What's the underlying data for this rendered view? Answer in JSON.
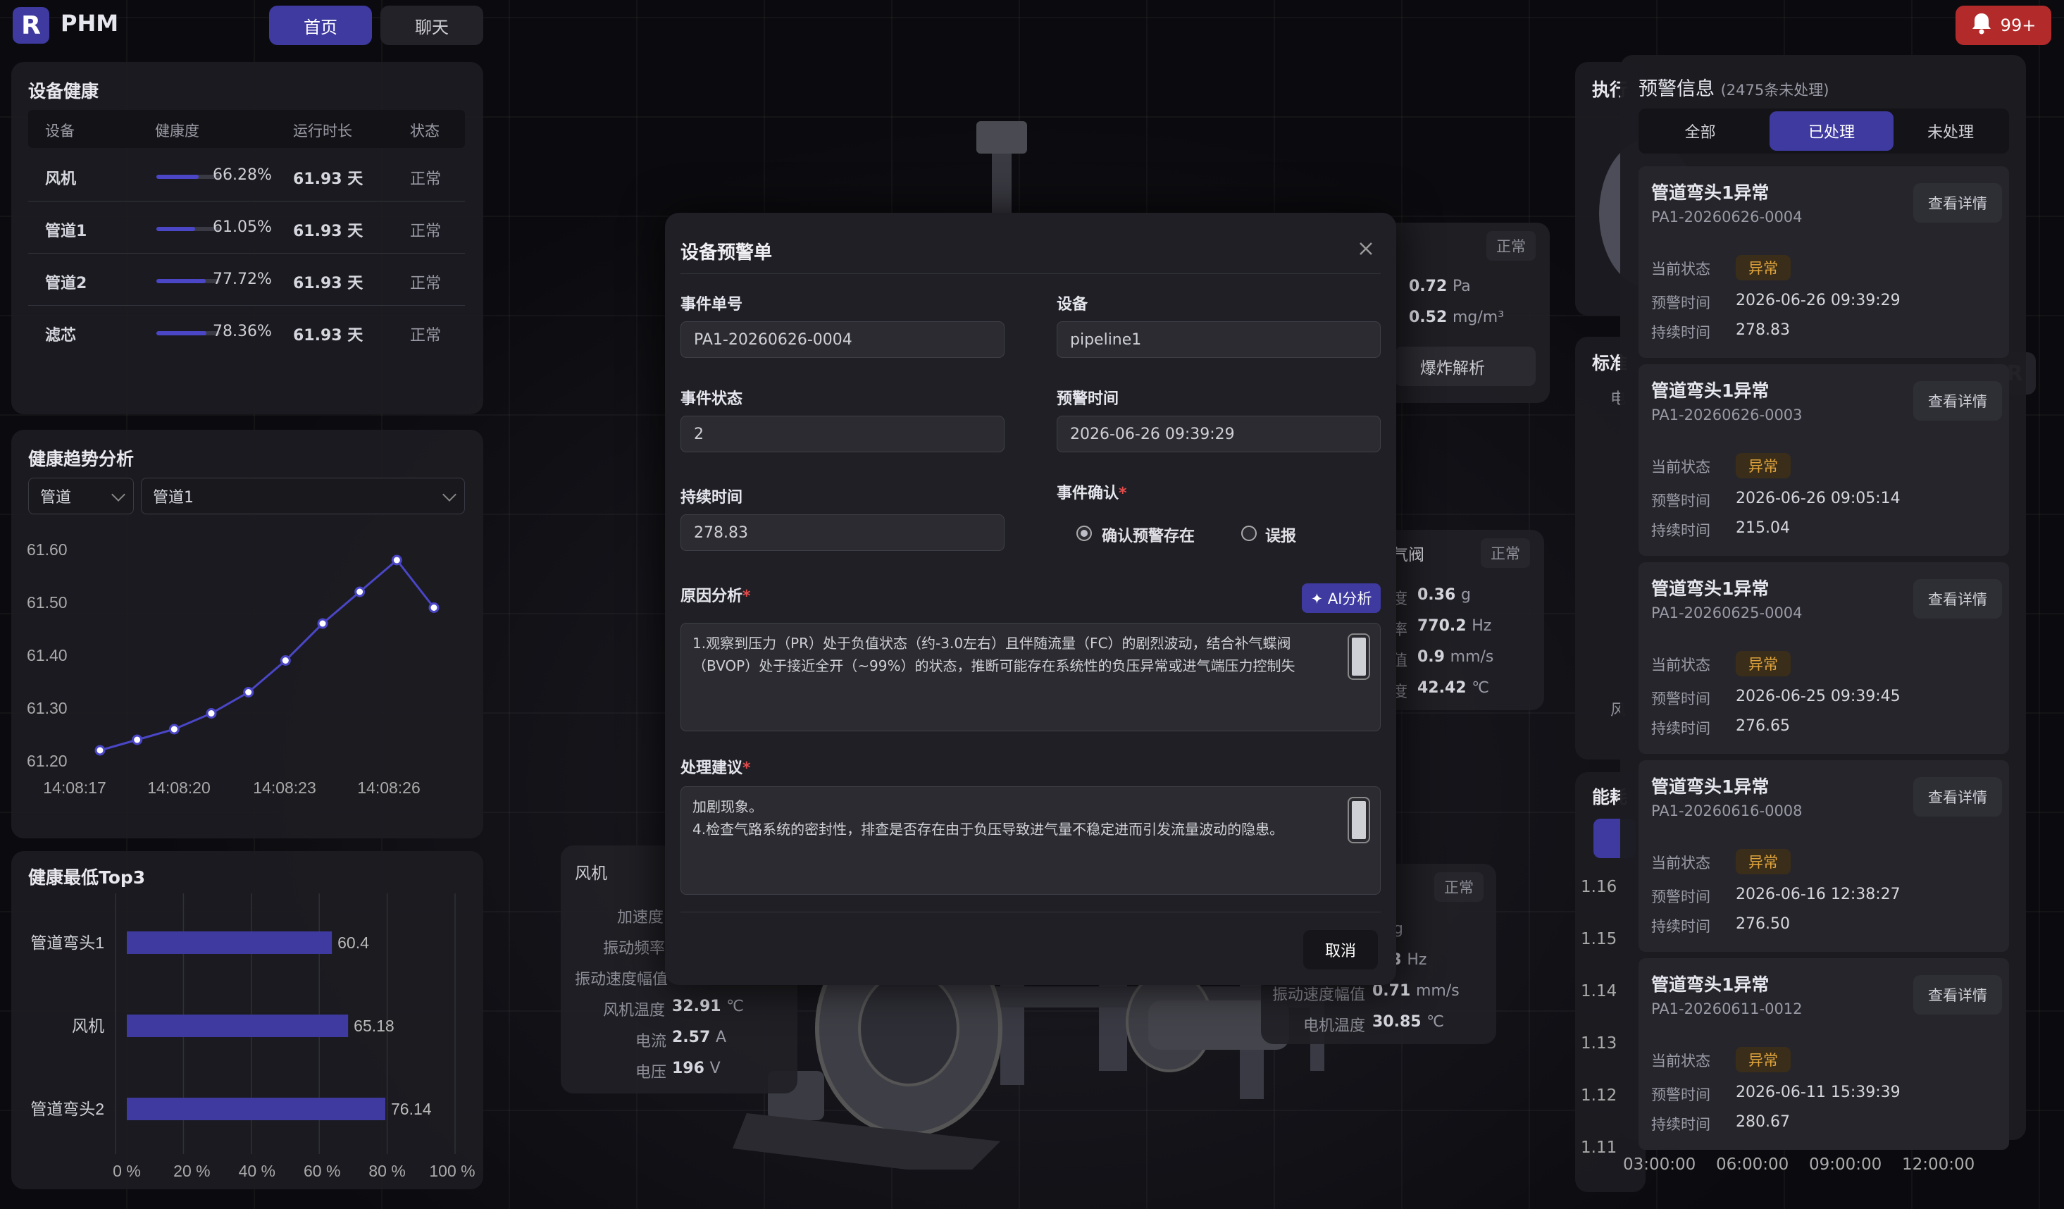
{
  "brand": {
    "logo": "R",
    "name": "PHM"
  },
  "nav": {
    "home": "首页",
    "chat": "聊天"
  },
  "notify": {
    "count": "99+"
  },
  "health": {
    "title": "设备健康",
    "headers": [
      "设备",
      "健康度",
      "运行时长",
      "状态"
    ],
    "rows": [
      {
        "name": "风机",
        "pct": "66.28%",
        "value": 0.6628,
        "runtime": "61.93 天",
        "status": "正常"
      },
      {
        "name": "管道1",
        "pct": "61.05%",
        "value": 0.6105,
        "runtime": "61.93 天",
        "status": "正常"
      },
      {
        "name": "管道2",
        "pct": "77.72%",
        "value": 0.7772,
        "runtime": "61.93 天",
        "status": "正常"
      },
      {
        "name": "滤芯",
        "pct": "78.36%",
        "value": 0.7836,
        "runtime": "61.93 天",
        "status": "正常"
      }
    ]
  },
  "trend": {
    "title": "健康趋势分析",
    "select_type": "管道",
    "select_device": "管道1"
  },
  "top3": {
    "title": "健康最低Top3"
  },
  "chart_data": [
    {
      "type": "line",
      "x": [
        "14:08:17",
        "",
        "",
        "",
        "",
        "",
        "",
        "",
        "",
        "",
        "14:08:20",
        "",
        "",
        "",
        "",
        "",
        "",
        "",
        "14:08:23",
        "",
        "",
        "",
        "",
        "",
        "",
        "14:08:26"
      ],
      "xticks": [
        "14:08:17",
        "14:08:20",
        "14:08:23",
        "14:08:26"
      ],
      "values": [
        61.22,
        61.24,
        61.26,
        61.29,
        61.33,
        61.39,
        61.46,
        61.52,
        61.58,
        61.49
      ],
      "yticks": [
        "61.60",
        "61.50",
        "61.40",
        "61.30",
        "61.20"
      ],
      "ylim": [
        61.2,
        61.6
      ],
      "grid": false
    },
    {
      "type": "bar",
      "orientation": "horizontal",
      "categories": [
        "管道弯头1",
        "风机",
        "管道弯头2"
      ],
      "values": [
        60.4,
        65.18,
        76.14
      ],
      "labels": [
        "60.4",
        "65.18",
        "76.14"
      ],
      "xticks": [
        "0 %",
        "20 %",
        "40 %",
        "60 %",
        "80 %",
        "100 %"
      ],
      "xlim": [
        0,
        100
      ],
      "grid": true
    }
  ],
  "bg_panels": {
    "fan": {
      "title": "风机",
      "labels": [
        "加速度",
        "振动频率",
        "振动速度幅值",
        "风机温度",
        "电流",
        "电压"
      ],
      "values": [
        "",
        "",
        "",
        "32.91",
        "2.57",
        "196"
      ],
      "units": [
        "",
        "",
        "",
        "℃",
        "A",
        "V"
      ]
    },
    "valve_top": {
      "status": "正常",
      "v1": "0.72",
      "u1": "Pa",
      "v2": "0.52",
      "u2": "mg/m³",
      "btn": "爆炸解析"
    },
    "valve": {
      "title": "气阀",
      "status": "正常",
      "labels": [
        "度",
        "率",
        "值",
        "度"
      ],
      "values": [
        "0.36",
        "770.2",
        "0.9",
        "42.42"
      ],
      "units": [
        "g",
        "Hz",
        "mm/s",
        "℃"
      ]
    },
    "motor": {
      "status": "正常",
      "labels": [
        "振动速度幅值",
        "电机温度"
      ],
      "values": [
        "0.71",
        "30.85"
      ],
      "units": [
        "mm/s",
        "℃"
      ],
      "partial": [
        ".3",
        "g"
      ],
      "partial_u": "Hz"
    },
    "right_chart": {
      "yticks": [
        "1.16",
        "1.15",
        "1.14",
        "1.13",
        "1.12",
        "1.11"
      ],
      "xticks": [
        "03:00:00",
        "06:00:00",
        "09:00:00",
        "12:00:00"
      ]
    },
    "stub_labels": [
      "执行",
      "标准",
      "能耗",
      "电",
      "风"
    ]
  },
  "modal": {
    "title": "设备预警单",
    "event_no_label": "事件单号",
    "event_no": "PA1-20260626-0004",
    "device_label": "设备",
    "device": "pipeline1",
    "status_label": "事件状态",
    "status": "2",
    "time_label": "预警时间",
    "time": "2026-06-26 09:39:29",
    "duration_label": "持续时间",
    "duration": "278.83",
    "confirm_label": "事件确认",
    "opt_confirm": "确认预警存在",
    "opt_false": "误报",
    "cause_label": "原因分析",
    "ai_btn": "✦ AI分析",
    "cause_line1": "1.观察到压力（PR）处于负值状态（约-3.0左右）且伴随流量（FC）的剧烈波动，结合补气蝶阀",
    "cause_line2": "（BVOP）处于接近全开（~99%）的状态，推断可能存在系统性的负压异常或进气端压力控制失",
    "advice_label": "处理建议",
    "advice_line1": "加剧现象。",
    "advice_line2": "4.检查气路系统的密封性，排查是否存在由于负压导致进气量不稳定进而引发流量波动的隐患。",
    "cancel": "取消"
  },
  "alerts": {
    "title": "预警信息",
    "count": "(2475条未处理)",
    "tabs": [
      "全部",
      "已处理",
      "未处理"
    ],
    "k_status": "当前状态",
    "k_time": "预警时间",
    "k_duration": "持续时间",
    "btn": "查看详情",
    "cards": [
      {
        "title": "管道弯头1异常",
        "id": "PA1-20260626-0004",
        "status": "异常",
        "time": "2026-06-26 09:39:29",
        "duration": "278.83"
      },
      {
        "title": "管道弯头1异常",
        "id": "PA1-20260626-0003",
        "status": "异常",
        "time": "2026-06-26 09:05:14",
        "duration": "215.04"
      },
      {
        "title": "管道弯头1异常",
        "id": "PA1-20260625-0004",
        "status": "异常",
        "time": "2026-06-25 09:39:45",
        "duration": "276.65"
      },
      {
        "title": "管道弯头1异常",
        "id": "PA1-20260616-0008",
        "status": "异常",
        "time": "2026-06-16 12:38:27",
        "duration": "276.50"
      },
      {
        "title": "管道弯头1异常",
        "id": "PA1-20260611-0012",
        "status": "异常",
        "time": "2026-06-11 15:39:39",
        "duration": "280.67"
      }
    ]
  },
  "colors": {
    "accent": "#3e3aa0",
    "bar": "#4a46c6",
    "alert": "#b22a2a",
    "warn": "#e3a53c"
  }
}
